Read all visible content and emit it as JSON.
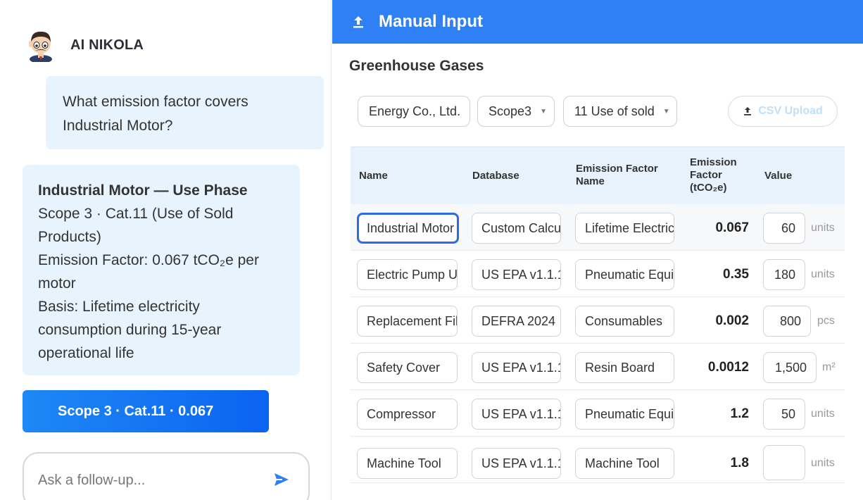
{
  "chat": {
    "agent_name": "AI NIKOLA",
    "user_message_line1": "What emission factor covers",
    "user_message_line2": "Industrial Motor?",
    "reply": {
      "title": "Industrial Motor — Use Phase",
      "line1": "Scope 3 · Cat.11 (Use of Sold",
      "line2": "Products)",
      "line3": "Emission Factor: 0.067 tCO₂e per",
      "line4": "motor",
      "line5": "Basis: Lifetime electricity",
      "line6": "consumption during 15-year",
      "line7": "operational life"
    },
    "action_button": "Scope 3 · Cat.11 · 0.067",
    "followup_placeholder": "Ask a follow-up..."
  },
  "header": {
    "title": "Manual Input"
  },
  "section_title": "Greenhouse Gases",
  "filters": {
    "company": "Energy Co., Ltd.",
    "scope": "Scope3",
    "category": "11 Use of sold",
    "csv_label": "CSV Upload"
  },
  "table": {
    "headers": {
      "name": "Name",
      "database": "Database",
      "ef_name_l1": "Emission Factor",
      "ef_name_l2": "Name",
      "ef_l1": "Emission",
      "ef_l2": "Factor",
      "ef_l3": "(tCO₂e)",
      "value": "Value"
    },
    "rows": [
      {
        "name": "Industrial Motor",
        "database": "Custom Calcu",
        "ef_name": "Lifetime Electric",
        "ef": "0.067",
        "value": "60",
        "unit": "units"
      },
      {
        "name": "Electric Pump U",
        "database": "US EPA v1.1.1",
        "ef_name": "Pneumatic Equi",
        "ef": "0.35",
        "value": "180",
        "unit": "units"
      },
      {
        "name": "Replacement Fil",
        "database": "DEFRA 2024",
        "ef_name": "Consumables",
        "ef": "0.002",
        "value": "800",
        "unit": "pcs"
      },
      {
        "name": "Safety Cover",
        "database": "US EPA v1.1.1",
        "ef_name": "Resin Board",
        "ef": "0.0012",
        "value": "1,500",
        "unit": "m²"
      },
      {
        "name": "Compressor",
        "database": "US EPA v1.1.1",
        "ef_name": "Pneumatic Equi",
        "ef": "1.2",
        "value": "50",
        "unit": "units"
      },
      {
        "name": "Machine Tool",
        "database": "US EPA v1.1.1",
        "ef_name": "Machine Tool",
        "ef": "1.8",
        "value": "",
        "unit": "units"
      }
    ]
  },
  "colors": {
    "accent": "#2f7ff5",
    "button_gradient_start": "#1e88f5",
    "button_gradient_end": "#0b63f0",
    "bubble": "#e8f4fd",
    "header_row": "#e7f2fd",
    "focus_border": "#2d6be0"
  },
  "icons": {
    "header": "upload-icon",
    "csv": "upload-icon",
    "send": "send-icon",
    "caret": "chevron-down-icon"
  }
}
